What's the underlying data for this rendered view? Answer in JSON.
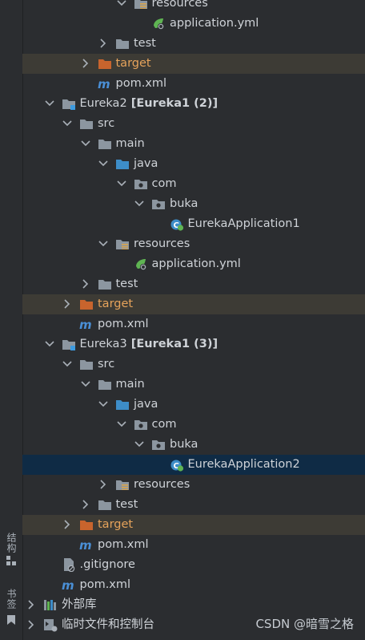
{
  "side": {
    "structure_label": "结构",
    "bookmarks_label": "书签"
  },
  "tree": [
    {
      "label": "resources"
    },
    {
      "label": "application.yml"
    },
    {
      "label": "test"
    },
    {
      "label": "target"
    },
    {
      "label": "pom.xml"
    },
    {
      "label": "Eureka2",
      "suffix": "[Eureka1 (2)]"
    },
    {
      "label": "src"
    },
    {
      "label": "main"
    },
    {
      "label": "java"
    },
    {
      "label": "com"
    },
    {
      "label": "buka"
    },
    {
      "label": "EurekaApplication1"
    },
    {
      "label": "resources"
    },
    {
      "label": "application.yml"
    },
    {
      "label": "test"
    },
    {
      "label": "target"
    },
    {
      "label": "pom.xml"
    },
    {
      "label": "Eureka3",
      "suffix": "[Eureka1 (3)]"
    },
    {
      "label": "src"
    },
    {
      "label": "main"
    },
    {
      "label": "java"
    },
    {
      "label": "com"
    },
    {
      "label": "buka"
    },
    {
      "label": "EurekaApplication2"
    },
    {
      "label": "resources"
    },
    {
      "label": "test"
    },
    {
      "label": "target"
    },
    {
      "label": "pom.xml"
    },
    {
      "label": ".gitignore"
    },
    {
      "label": "pom.xml"
    },
    {
      "label": "外部库"
    },
    {
      "label": "临时文件和控制台"
    }
  ],
  "watermark": "CSDN @暗雪之格"
}
